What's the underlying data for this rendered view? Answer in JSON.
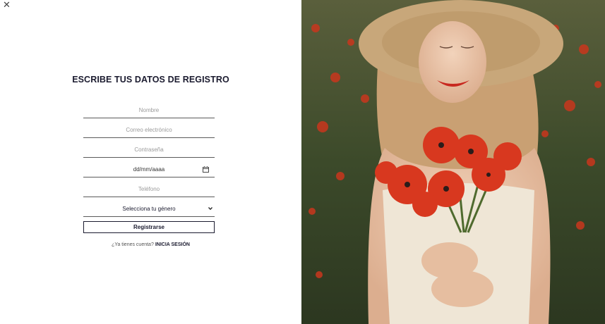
{
  "close_icon": "close-icon",
  "form": {
    "title": "ESCRIBE TUS DATOS DE REGISTRO",
    "name_placeholder": "Nombre",
    "email_placeholder": "Correo electrónico",
    "password_placeholder": "Contraseña",
    "date_value": "dd/mm/aaaa",
    "phone_placeholder": "Teléfono",
    "gender_selected": "Selecciona tu género",
    "submit_label": "Registrarse"
  },
  "login": {
    "prompt": "¿Ya tienes cuenta?",
    "link": "INICIA SESIÓN"
  },
  "colors": {
    "text_dark": "#1b1b2f",
    "photo_bg": "#3b4a2c",
    "poppy_red": "#d8381f",
    "hat": "#c8a77a"
  }
}
